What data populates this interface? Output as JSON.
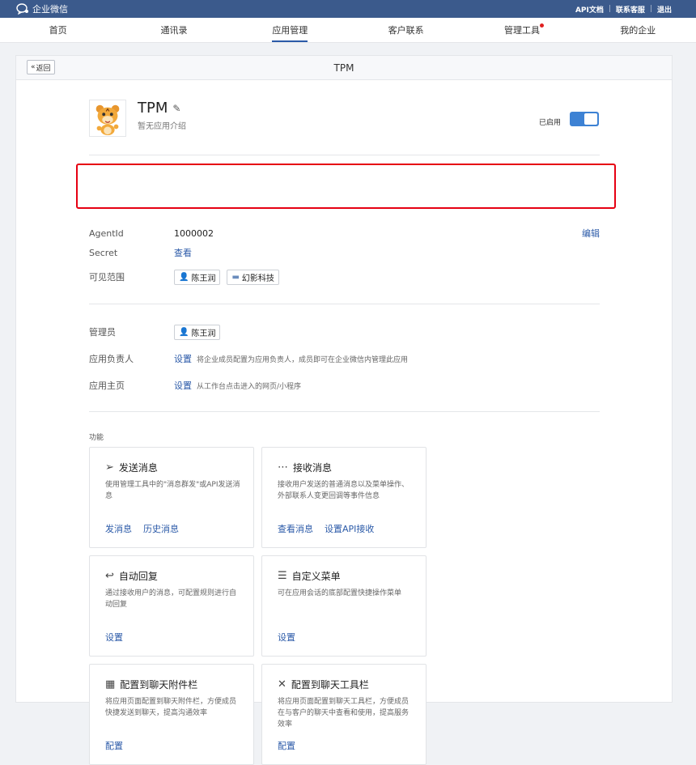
{
  "topbar": {
    "brand": "企业微信",
    "links": [
      "API文档",
      "联系客服",
      "退出"
    ]
  },
  "nav": {
    "items": [
      "首页",
      "通讯录",
      "应用管理",
      "客户联系",
      "管理工具",
      "我的企业"
    ],
    "active_index": 2
  },
  "panel": {
    "back_label": "返回",
    "title": "TPM"
  },
  "app": {
    "name": "TPM",
    "description": "暂无应用介绍",
    "status_label": "已启用",
    "enabled": true
  },
  "fields": {
    "agentid_label": "AgentId",
    "agentid_value": "1000002",
    "edit_label": "编辑",
    "secret_label": "Secret",
    "secret_action": "查看",
    "scope_label": "可见范围",
    "scope_user": "陈王润",
    "scope_dept": "幻影科技",
    "admin_label": "管理员",
    "admin_user": "陈王润",
    "owner_label": "应用负责人",
    "owner_action": "设置",
    "owner_hint": "将企业成员配置为应用负责人，成员即可在企业微信内管理此应用",
    "homepage_label": "应用主页",
    "homepage_action": "设置",
    "homepage_hint": "从工作台点击进入的网页/小程序"
  },
  "features": {
    "section_title": "功能",
    "cards": [
      {
        "title": "发送消息",
        "icon": "send-icon",
        "desc": "使用管理工具中的\"消息群发\"或API发送消息",
        "links": [
          "发消息",
          "历史消息"
        ]
      },
      {
        "title": "接收消息",
        "icon": "chat-icon",
        "desc": "接收用户发送的普通消息以及菜单操作、外部联系人变更回调等事件信息",
        "links": [
          "查看消息",
          "设置API接收"
        ]
      },
      {
        "title": "自动回复",
        "icon": "reply-icon",
        "desc": "通过接收用户的消息，可配置规则进行自动回复",
        "links": [
          "设置"
        ]
      },
      {
        "title": "自定义菜单",
        "icon": "menu-icon",
        "desc": "可在应用会话的底部配置快捷操作菜单",
        "links": [
          "设置"
        ]
      },
      {
        "title": "配置到聊天附件栏",
        "icon": "attachment-grid-icon",
        "desc": "将应用页面配置到聊天附件栏，方便成员快捷发送到聊天，提高沟通效率",
        "links": [
          "配置"
        ]
      },
      {
        "title": "配置到聊天工具栏",
        "icon": "toolbar-icon",
        "desc": "将应用页面配置到聊天工具栏，方便成员在与客户的聊天中查看和使用，提高服务效率",
        "links": [
          "配置"
        ]
      }
    ]
  }
}
